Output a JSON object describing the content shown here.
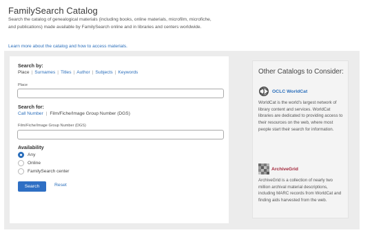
{
  "header": {
    "title": "FamilySearch Catalog",
    "intro": "Search the catalog of genealogical materials (including books, online materials, microfilm, microfiche, and publications) made available by FamilySearch online and in libraries and centers worldwide.",
    "learn_more": "Learn more about the catalog and how to access materials."
  },
  "search_by": {
    "label": "Search by:",
    "tabs": [
      "Place",
      "Surnames",
      "Titles",
      "Author",
      "Subjects",
      "Keywords"
    ],
    "active_index": 0,
    "field_label": "Place",
    "field_value": ""
  },
  "search_for": {
    "label": "Search for:",
    "options": [
      "Call Number",
      "Film/Fiche/Image Group Number (DGS)"
    ],
    "active_index": 1,
    "field_label": "Film/Fiche/Image Group Number (DGS)",
    "field_value": ""
  },
  "availability": {
    "label": "Availability",
    "options": [
      "Any",
      "Online",
      "FamilySearch center"
    ],
    "selected_index": 0
  },
  "actions": {
    "search": "Search",
    "reset": "Reset"
  },
  "sidebar": {
    "title": "Other Catalogs to Consider:",
    "worldcat": {
      "name": "OCLC WorldCat",
      "description": "WorldCat is the world's largest network of library content and services. WorldCat libraries are dedicated to providing access to their resources on the web, where most people start their search for information."
    },
    "archivegrid": {
      "name": "ArchiveGrid",
      "description": "ArchiveGrid is a collection of nearly two million archival material descriptions, including MARC records from WorldCat and finding aids harvested from the web."
    }
  },
  "colors": {
    "link": "#2a6ebb",
    "button": "#2e6fc4",
    "panel_border": "#ececec",
    "archivegrid_brand": "#a3263a"
  }
}
